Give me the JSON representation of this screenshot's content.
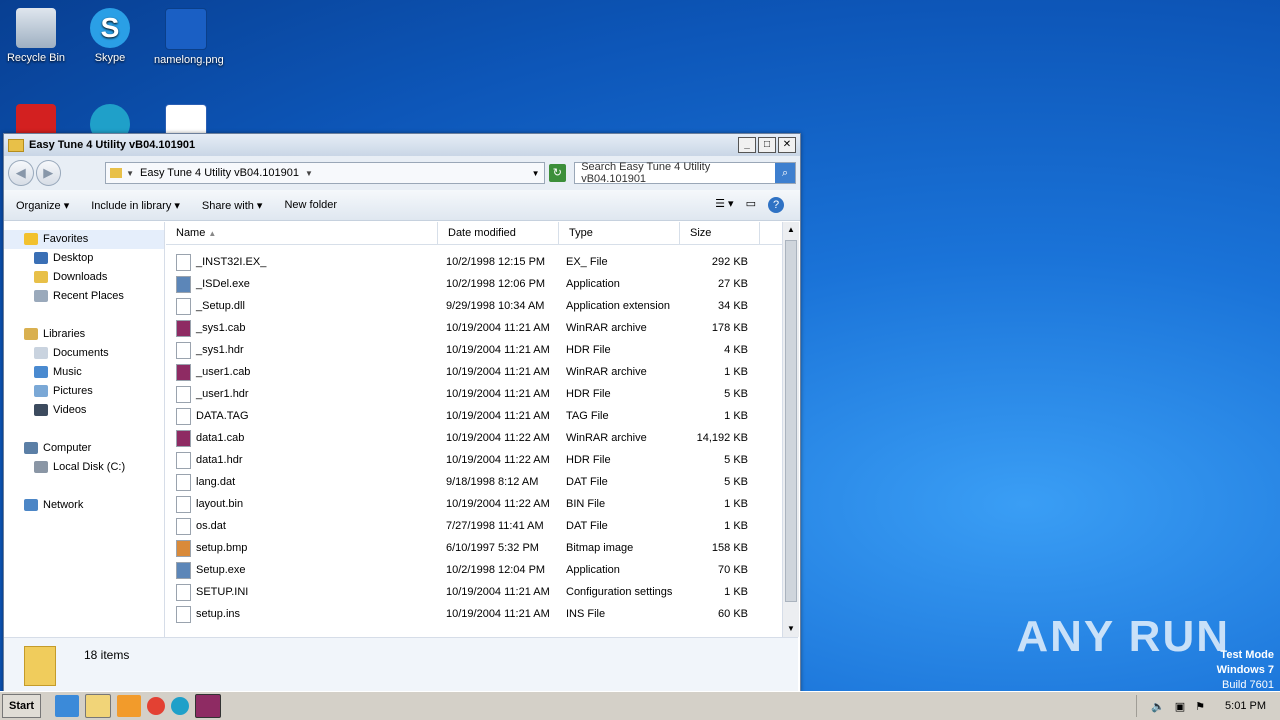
{
  "desktop": {
    "icons": [
      {
        "label": "Recycle Bin"
      },
      {
        "label": "Skype"
      },
      {
        "label": "namelong.png"
      }
    ]
  },
  "window": {
    "title": "Easy Tune 4 Utility vB04.101901",
    "address": "Easy Tune 4 Utility vB04.101901",
    "search_placeholder": "Search Easy Tune 4 Utility vB04.101901",
    "toolbar": {
      "organize": "Organize",
      "include": "Include in library",
      "share": "Share with",
      "new_folder": "New folder"
    },
    "nav": {
      "favorites": "Favorites",
      "desktop": "Desktop",
      "downloads": "Downloads",
      "recent": "Recent Places",
      "libraries": "Libraries",
      "documents": "Documents",
      "music": "Music",
      "pictures": "Pictures",
      "videos": "Videos",
      "computer": "Computer",
      "local_disk": "Local Disk (C:)",
      "network": "Network"
    },
    "columns": {
      "name": "Name",
      "date": "Date modified",
      "type": "Type",
      "size": "Size"
    },
    "files": [
      {
        "name": "_INST32I.EX_",
        "date": "10/2/1998 12:15 PM",
        "type": "EX_ File",
        "size": "292 KB"
      },
      {
        "name": "_ISDel.exe",
        "date": "10/2/1998 12:06 PM",
        "type": "Application",
        "size": "27 KB"
      },
      {
        "name": "_Setup.dll",
        "date": "9/29/1998 10:34 AM",
        "type": "Application extension",
        "size": "34 KB"
      },
      {
        "name": "_sys1.cab",
        "date": "10/19/2004 11:21 AM",
        "type": "WinRAR archive",
        "size": "178 KB"
      },
      {
        "name": "_sys1.hdr",
        "date": "10/19/2004 11:21 AM",
        "type": "HDR File",
        "size": "4 KB"
      },
      {
        "name": "_user1.cab",
        "date": "10/19/2004 11:21 AM",
        "type": "WinRAR archive",
        "size": "1 KB"
      },
      {
        "name": "_user1.hdr",
        "date": "10/19/2004 11:21 AM",
        "type": "HDR File",
        "size": "5 KB"
      },
      {
        "name": "DATA.TAG",
        "date": "10/19/2004 11:21 AM",
        "type": "TAG File",
        "size": "1 KB"
      },
      {
        "name": "data1.cab",
        "date": "10/19/2004 11:22 AM",
        "type": "WinRAR archive",
        "size": "14,192 KB"
      },
      {
        "name": "data1.hdr",
        "date": "10/19/2004 11:22 AM",
        "type": "HDR File",
        "size": "5 KB"
      },
      {
        "name": "lang.dat",
        "date": "9/18/1998 8:12 AM",
        "type": "DAT File",
        "size": "5 KB"
      },
      {
        "name": "layout.bin",
        "date": "10/19/2004 11:22 AM",
        "type": "BIN File",
        "size": "1 KB"
      },
      {
        "name": "os.dat",
        "date": "7/27/1998 11:41 AM",
        "type": "DAT File",
        "size": "1 KB"
      },
      {
        "name": "setup.bmp",
        "date": "6/10/1997 5:32 PM",
        "type": "Bitmap image",
        "size": "158 KB"
      },
      {
        "name": "Setup.exe",
        "date": "10/2/1998 12:04 PM",
        "type": "Application",
        "size": "70 KB"
      },
      {
        "name": "SETUP.INI",
        "date": "10/19/2004 11:21 AM",
        "type": "Configuration settings",
        "size": "1 KB"
      },
      {
        "name": "setup.ins",
        "date": "10/19/2004 11:21 AM",
        "type": "INS File",
        "size": "60 KB"
      }
    ],
    "status": "18 items"
  },
  "taskbar": {
    "start": "Start",
    "time": "5:01 PM"
  },
  "watermark": "ANY RUN",
  "testmode": {
    "line1": "Test Mode",
    "line2": "Windows 7",
    "line3": "Build 7601"
  }
}
